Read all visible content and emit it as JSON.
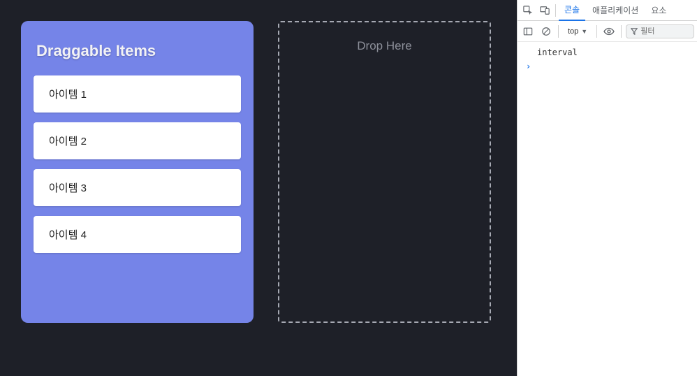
{
  "app": {
    "source_panel": {
      "title": "Draggable Items",
      "items": [
        "아이템 1",
        "아이템 2",
        "아이템 3",
        "아이템 4"
      ]
    },
    "drop_panel": {
      "placeholder": "Drop Here"
    }
  },
  "devtools": {
    "tabs": {
      "console": "콘솔",
      "application": "애플리케이션",
      "elements": "요소"
    },
    "active_tab": "console",
    "console_toolbar": {
      "context_label": "top",
      "filter_placeholder": "필터"
    },
    "console": {
      "log_lines": [
        "interval"
      ],
      "prompt": ""
    }
  }
}
